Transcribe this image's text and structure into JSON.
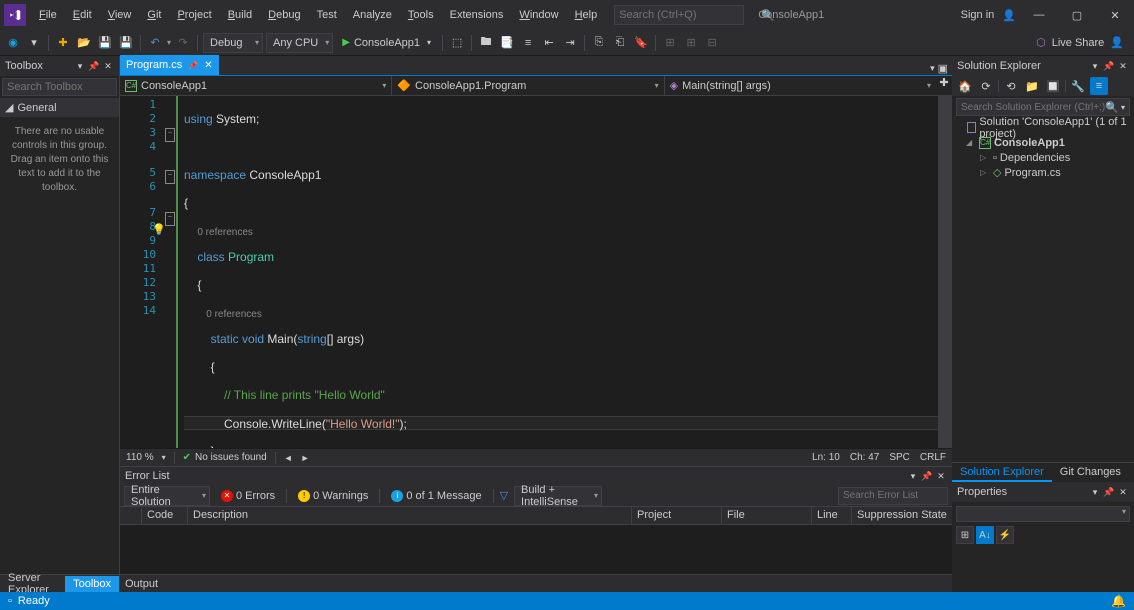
{
  "menus": [
    "File",
    "Edit",
    "View",
    "Git",
    "Project",
    "Build",
    "Debug",
    "Test",
    "Analyze",
    "Tools",
    "Extensions",
    "Window",
    "Help"
  ],
  "search_placeholder": "Search (Ctrl+Q)",
  "app_name": "ConsoleApp1",
  "sign_in": "Sign in",
  "toolbar": {
    "config": "Debug",
    "platform": "Any CPU",
    "start": "ConsoleApp1",
    "liveshare": "Live Share"
  },
  "toolbox": {
    "title": "Toolbox",
    "search": "Search Toolbox",
    "group": "General",
    "msg": "There are no usable controls in this group. Drag an item onto this text to add it to the toolbox."
  },
  "tab": {
    "name": "Program.cs"
  },
  "nav": {
    "a": "ConsoleApp1",
    "b": "ConsoleApp1.Program",
    "c": "Main(string[] args)"
  },
  "zoom": "110 %",
  "issues": "No issues found",
  "caret": {
    "ln": "Ln: 10",
    "ch": "Ch: 47",
    "spc": "SPC",
    "crlf": "CRLF"
  },
  "errorlist": {
    "title": "Error List",
    "scope": "Entire Solution",
    "errs": "0 Errors",
    "warns": "0 Warnings",
    "msgs": "0 of 1 Message",
    "build": "Build + IntelliSense",
    "search": "Search Error List",
    "cols": [
      "",
      "Code",
      "Description",
      "Project",
      "File",
      "Line",
      "Suppression State"
    ]
  },
  "btabs": {
    "server": "Server Explorer",
    "toolbox": "Toolbox"
  },
  "output": "Output",
  "se": {
    "title": "Solution Explorer",
    "search": "Search Solution Explorer (Ctrl+;)",
    "sln": "Solution 'ConsoleApp1' (1 of 1 project)",
    "proj": "ConsoleApp1",
    "deps": "Dependencies",
    "file": "Program.cs"
  },
  "rtabs": {
    "se": "Solution Explorer",
    "git": "Git Changes"
  },
  "props": {
    "title": "Properties"
  },
  "status": "Ready",
  "code": {
    "l1a": "using",
    "l1b": " System;",
    "l3a": "namespace",
    "l3b": " ConsoleApp1",
    "l4": "{",
    "ref0": "0 references",
    "l5a": "    class",
    "l5b": " Program",
    "l6": "    {",
    "ref1": "        0 references",
    "l7a": "        static",
    "l7b": " void",
    "l7c": " Main(",
    "l7d": "string",
    "l7e": "[] args)",
    "l8": "        {",
    "l9": "            // This line prints \"Hello World\"",
    "l10a": "            Console.WriteLine(",
    "l10b": "\"Hello World!\"",
    "l10c": ");",
    "l11": "        }",
    "l12": "    }",
    "l13": "}"
  }
}
